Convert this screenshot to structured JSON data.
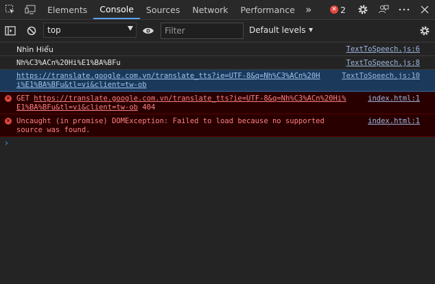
{
  "tabs": [
    {
      "label": "Elements"
    },
    {
      "label": "Console"
    },
    {
      "label": "Sources"
    },
    {
      "label": "Network"
    },
    {
      "label": "Performance"
    }
  ],
  "more_tabs_glyph": "»",
  "error_count": "2",
  "toolbar": {
    "context": "top",
    "filter_placeholder": "Filter",
    "levels": "Default levels"
  },
  "messages": [
    {
      "text": "Nhìn Hiểu",
      "source": "TextToSpeech.js:6"
    },
    {
      "text": "Nh%C3%ACn%20Hi%E1%BA%BFu",
      "source": "TextToSpeech.js:8"
    },
    {
      "line1": "https://translate.google.com.vn/translate_tts?ie=UTF-8&q=Nh%C3%ACn%20H",
      "line2": "i%E1%BA%BFu&tl=vi&client=tw-ob",
      "source": "TextToSpeech.js:10"
    }
  ],
  "errors": [
    {
      "prefix": "GET ",
      "url1": "https://translate.google.com.vn/translate_tts?ie=UTF-8&q=Nh%C3%ACn%20Hi%",
      "url2": "E1%BA%BFu&tl=vi&client=tw-ob",
      "status": " 404",
      "source": "index.html:1"
    },
    {
      "line1": "Uncaught (in promise) DOMException: Failed to load because no supported",
      "line2": "source was found.",
      "source": "index.html:1"
    }
  ],
  "prompt_glyph": "›"
}
